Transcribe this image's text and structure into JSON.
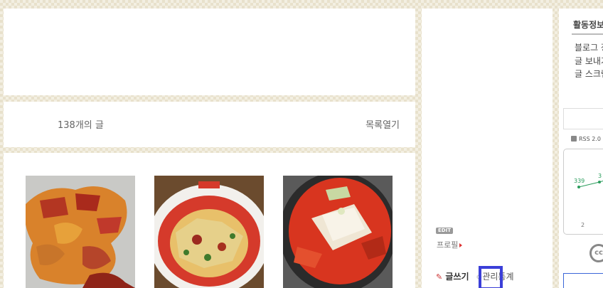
{
  "content": {
    "post_count": "138개의 글",
    "list_toggle": "목록열기"
  },
  "sidebar": {
    "edit_badge": "EDIT",
    "profile": "프로필",
    "write": "글쓰기",
    "manage": "관리",
    "stats": "통계"
  },
  "right": {
    "activity_title": "활동정보",
    "items": [
      "블로그 정보",
      "글 보내기",
      "글 스크랩"
    ],
    "rss": "RSS 2.0",
    "chart_labels": [
      "339",
      "3"
    ],
    "chart_axis": "2"
  },
  "colors": {
    "highlight": "#3b3fd8",
    "chart_line": "#2a9d5c"
  },
  "icons": [
    "pencil-icon",
    "gear-icon",
    "rss-icon",
    "cc-icon"
  ]
}
